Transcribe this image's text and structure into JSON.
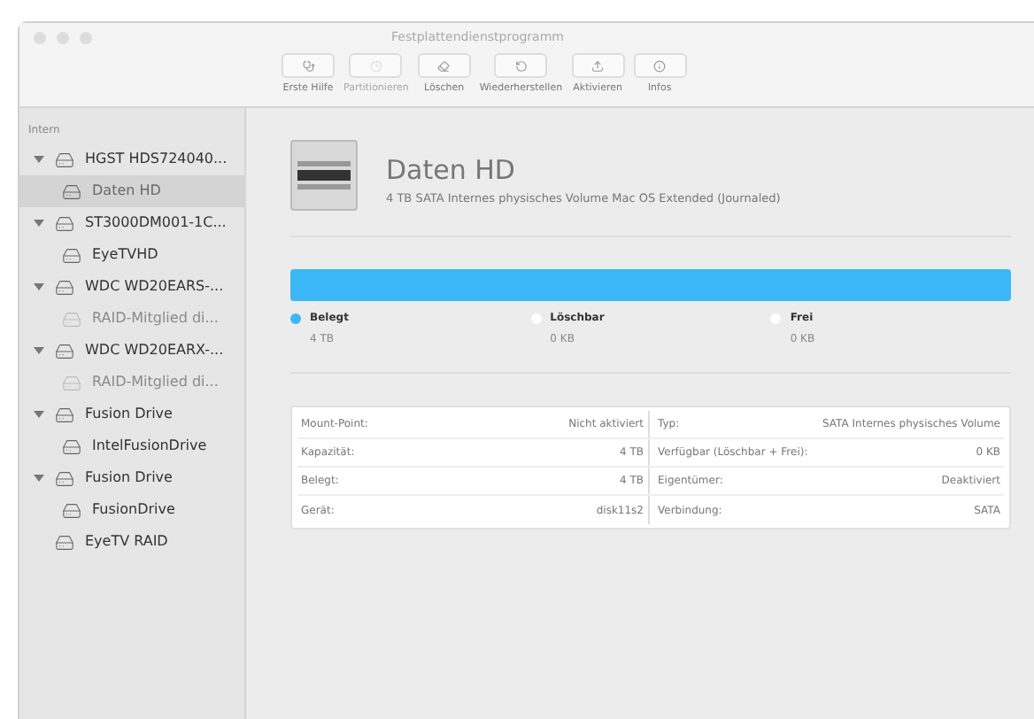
{
  "window": {
    "title": "Festplattendienstprogramm"
  },
  "toolbar": [
    {
      "label": "Erste Hilfe",
      "disabled": false
    },
    {
      "label": "Partitionieren",
      "disabled": true
    },
    {
      "label": "Löschen",
      "disabled": false
    },
    {
      "label": "Wiederherstellen",
      "disabled": false
    },
    {
      "label": "Aktivieren",
      "disabled": false
    },
    {
      "label": "Infos",
      "disabled": false
    }
  ],
  "sidebar": {
    "section": "Intern",
    "items": [
      {
        "label": "HGST HDS724040...",
        "expanded": true,
        "selected": false,
        "disabled": false,
        "children": [
          {
            "label": "Daten HD",
            "selected": true,
            "disabled": false
          }
        ]
      },
      {
        "label": "ST3000DM001-1C...",
        "expanded": true,
        "selected": false,
        "disabled": false,
        "children": [
          {
            "label": "EyeTVHD",
            "selected": false,
            "disabled": false
          }
        ]
      },
      {
        "label": "WDC WD20EARS-...",
        "expanded": true,
        "selected": false,
        "disabled": false,
        "children": [
          {
            "label": "RAID-Mitglied di...",
            "selected": false,
            "disabled": true
          }
        ]
      },
      {
        "label": "WDC WD20EARX-...",
        "expanded": true,
        "selected": false,
        "disabled": false,
        "children": [
          {
            "label": "RAID-Mitglied di...",
            "selected": false,
            "disabled": true
          }
        ]
      },
      {
        "label": "Fusion Drive",
        "expanded": true,
        "selected": false,
        "disabled": false,
        "children": [
          {
            "label": "IntelFusionDrive",
            "selected": false,
            "disabled": false
          }
        ]
      },
      {
        "label": "Fusion Drive",
        "expanded": true,
        "selected": false,
        "disabled": false,
        "children": [
          {
            "label": "FusionDrive",
            "selected": false,
            "disabled": false
          }
        ]
      },
      {
        "label": "EyeTV RAID",
        "selected": false,
        "disabled": false
      }
    ]
  },
  "volume": {
    "name": "Daten HD",
    "description": "4 TB SATA Internes physisches Volume Mac OS Extended (Journaled)"
  },
  "usage": {
    "level": 1,
    "legend": [
      {
        "label": "Belegt",
        "value": "4 TB",
        "color": "#3bb8f5"
      },
      {
        "label": "Löschbar",
        "value": "0 KB",
        "color": "#ffffff"
      },
      {
        "label": "Frei",
        "value": "0 KB",
        "color": "#ffffff"
      }
    ]
  },
  "info": [
    [
      {
        "label": "Mount-Point:",
        "value": "Nicht aktiviert"
      },
      {
        "label": "Typ:",
        "value": "SATA Internes physisches Volume"
      }
    ],
    [
      {
        "label": "Kapazität:",
        "value": "4 TB"
      },
      {
        "label": "Verfügbar (Löschbar + Frei):",
        "value": "0 KB"
      }
    ],
    [
      {
        "label": "Belegt:",
        "value": "4 TB"
      },
      {
        "label": "Eigentümer:",
        "value": "Deaktiviert"
      }
    ],
    [
      {
        "label": "Gerät:",
        "value": "disk11s2"
      },
      {
        "label": "Verbindung:",
        "value": "SATA"
      }
    ]
  ]
}
